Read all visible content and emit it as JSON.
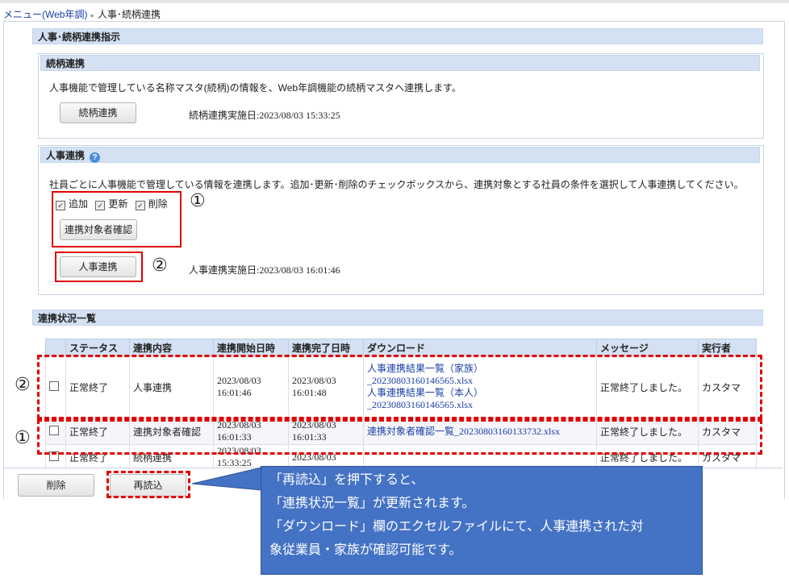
{
  "breadcrumb": {
    "menu": "メニュー(Web年調)",
    "current": "人事･続柄連携"
  },
  "main_title": "人事･続柄連携指示",
  "zokugara": {
    "title": "続柄連携",
    "description": "人事機能で管理している名称マスタ(続柄)の情報を、Web年調機能の続柄マスタへ連携します。",
    "button": "続柄連携",
    "date_text": "続柄連携実施日:2023/08/03 15:33:25"
  },
  "jinji": {
    "title": "人事連携",
    "help_icon": "help-icon",
    "description": "社員ごとに人事機能で管理している情報を連携します。追加･更新･削除のチェックボックスから、連携対象とする社員の条件を選択して人事連携してください。",
    "checkboxes": [
      {
        "label": "追加",
        "checked": true
      },
      {
        "label": "更新",
        "checked": true
      },
      {
        "label": "削除",
        "checked": true
      }
    ],
    "confirm_button": "連携対象者確認",
    "button": "人事連携",
    "date_text": "人事連携実施日:2023/08/03 16:01:46"
  },
  "status_list": {
    "title": "連携状況一覧",
    "columns": [
      "",
      "ステータス",
      "連携内容",
      "連携開始日時",
      "連携完了日時",
      "ダウンロード",
      "メッセージ",
      "実行者"
    ],
    "rows": [
      {
        "status": "正常終了",
        "content": "人事連携",
        "start": [
          "2023/08/03",
          "16:01:46"
        ],
        "end": [
          "2023/08/03",
          "16:01:48"
        ],
        "downloads": [
          "人事連携結果一覧（家族）",
          "_20230803160146565.xlsx",
          "人事連携結果一覧（本人）",
          "_20230803160146565.xlsx"
        ],
        "message": "正常終了しました。",
        "user": "カスタマ"
      },
      {
        "status": "正常終了",
        "content": "連携対象者確認",
        "start": [
          "2023/08/03",
          "16:01:33"
        ],
        "end": [
          "2023/08/03",
          "16:01:33"
        ],
        "downloads": [
          "連携対象者確認一覧_20230803160133732.xlsx"
        ],
        "message": "正常終了しました。",
        "user": "カスタマ"
      },
      {
        "status": "正常終了",
        "content": "続柄連携",
        "start": [
          "2023/08/03",
          "15:33:25"
        ],
        "end": [
          "2023/08/03",
          ""
        ],
        "downloads": [],
        "message": "正常終了しました。",
        "user": "カスタマ"
      }
    ]
  },
  "footer": {
    "delete_button": "削除",
    "reload_button": "再読込"
  },
  "annotations": {
    "mark1": "①",
    "mark2": "②"
  },
  "callout": {
    "lines": [
      "「再読込」を押下すると、",
      "「連携状況一覧」が更新されます。",
      "「ダウンロード」欄のエクセルファイルにて、人事連携された対",
      "象従業員・家族が確認可能です。"
    ]
  },
  "colors": {
    "header_bg": "#d3e1f3",
    "highlight": "#e00000",
    "callout_bg": "#4472c4",
    "link": "#1a3ea8"
  }
}
